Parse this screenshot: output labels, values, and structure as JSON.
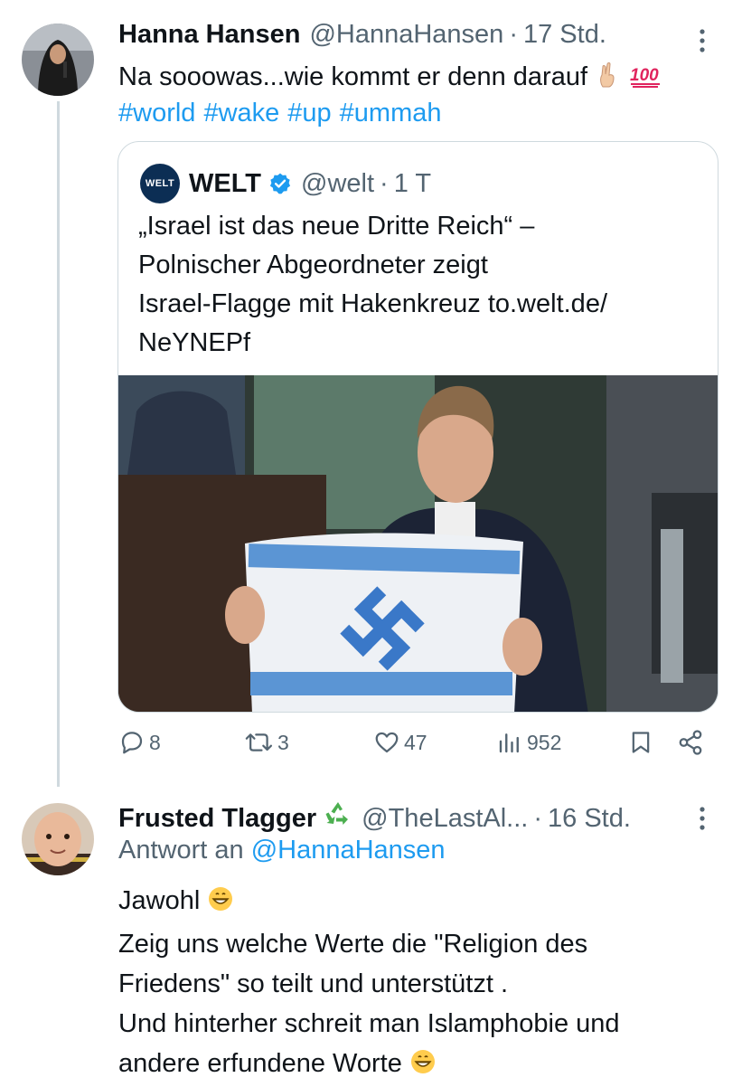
{
  "tweet": {
    "author_name": "Hanna Hansen",
    "handle": "@HannaHansen",
    "separator": "·",
    "time": "17 Std.",
    "text": "Na sooowas...wie kommt er denn darauf",
    "text_emojis": [
      "victory-hand-emoji",
      "hundred-points-emoji"
    ],
    "hashtags": [
      "#world",
      "#wake",
      "#up",
      "#ummah"
    ]
  },
  "quote": {
    "logo_text": "WELT",
    "author_name": "WELT",
    "handle": "@welt",
    "separator": "·",
    "time": "1 T",
    "text_lines": [
      "„Israel ist das neue Dritte Reich“ –",
      "Polnischer Abgeordneter zeigt",
      "Israel-Flagge mit Hakenkreuz to.welt.de/",
      "NeYNEPf"
    ]
  },
  "actions": {
    "replies": "8",
    "reposts": "3",
    "likes": "47",
    "views": "952"
  },
  "reply": {
    "author_name": "Frusted Tlagger",
    "name_emoji": "recycle-emoji",
    "handle": "@TheLastAl...",
    "separator": "·",
    "time": "16 Std.",
    "reply_to_label": "Antwort an",
    "reply_to_handle": "@HannaHansen",
    "lines": [
      "Jawohl",
      "Zeig uns welche Werte die \"Religion des",
      "Friedens\" so teilt und unterstützt .",
      "Und hinterher schreit man Islamphobie und",
      "andere erfundene Worte"
    ]
  },
  "colors": {
    "text": "#0f1419",
    "muted": "#536471",
    "link": "#1d9bf0",
    "border": "#cfd9de",
    "verified": "#1d9bf0"
  }
}
